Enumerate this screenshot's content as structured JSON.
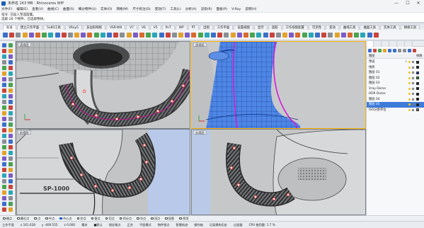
{
  "window": {
    "title": "未命名 163 MB - Rhinoceros WIP",
    "controls": [
      "—",
      "☐",
      "✕"
    ]
  },
  "menu": [
    "文件(F)",
    "编辑(E)",
    "查看(V)",
    "曲线(C)",
    "曲面(S)",
    "细分物件(U)",
    "实体(O)",
    "网格(M)",
    "尺寸标注(D)",
    "变动(T)",
    "工具(L)",
    "分析(A)",
    "渲染(R)",
    "面板(P)",
    "V-Ray",
    "说明(H)"
  ],
  "command": {
    "history": "指令: 已加入至选取集。",
    "prompt": "选取 28 个物件，已选取物体。"
  },
  "toolbar_tabs": [
    "标准",
    "建立工作平面",
    "5x80工具",
    "VRay5",
    "多边形网格",
    "VSR-W8",
    "V7",
    "V6",
    "V5",
    "PnT",
    "WP",
    "PT",
    "出图",
    "工作平面",
    "设置视图",
    "显示",
    "选取",
    "工作视窗配置",
    "可见性",
    "变动",
    "曲线工具",
    "曲面工具",
    "实体工具",
    "网格工具"
  ],
  "toolbar_active": 0,
  "viewports": [
    {
      "name": "Top",
      "title": "透视图"
    },
    {
      "name": "Perspective",
      "title": "透视图"
    },
    {
      "name": "Front",
      "title": "前视图"
    },
    {
      "name": "Right",
      "title": "右视图"
    }
  ],
  "panel": {
    "header": [
      "图层",
      "材质"
    ],
    "layers": [
      {
        "name": "预设",
        "check": "✓",
        "color": "#000000",
        "selected": false
      },
      {
        "name": "线条",
        "check": "",
        "color": "#1a1a1a",
        "selected": false
      },
      {
        "name": "图层 01",
        "check": "",
        "color": "#1a3cc9",
        "selected": false
      },
      {
        "name": "图层 02",
        "check": "",
        "color": "#119922",
        "selected": false
      },
      {
        "name": "图层 03",
        "check": "",
        "color": "#222222",
        "selected": false
      },
      {
        "name": "Vray Dome",
        "check": "",
        "color": "#111111",
        "selected": false
      },
      {
        "name": "HDR Dome",
        "check": "",
        "color": "#111111",
        "selected": false
      },
      {
        "name": "图层 04",
        "check": "",
        "color": "#111111",
        "selected": false
      },
      {
        "name": "图层 05",
        "check": "",
        "color": "#111111",
        "selected": true
      },
      {
        "name": "ISO分割单位",
        "check": "",
        "color": "#777777",
        "selected": false
      }
    ]
  },
  "viewport_tabs": [
    "透视图",
    "上视图",
    "前视图",
    "右视图",
    "+"
  ],
  "osnap": [
    {
      "label": "端点",
      "on": false
    },
    {
      "label": "最近点",
      "on": false
    },
    {
      "label": "点",
      "on": false
    },
    {
      "label": "中点",
      "on": false
    },
    {
      "label": "中心点",
      "on": true
    },
    {
      "label": "交点",
      "on": false
    },
    {
      "label": "垂点",
      "on": false
    },
    {
      "label": "切点",
      "on": false
    },
    {
      "label": "四分点",
      "on": false
    },
    {
      "label": "节点",
      "on": false
    },
    {
      "label": "顶点",
      "on": false
    },
    {
      "label": "投影",
      "on": false
    },
    {
      "label": "停用",
      "on": false
    }
  ],
  "status": {
    "cplane": "工作平面",
    "x": "x 161.628",
    "y": "y -409.555",
    "z": "z 0.000",
    "units": "毫米",
    "layer": "■默认",
    "grid_snap": "锁定格点",
    "ortho": "正交",
    "planar": "平面模式",
    "osnap": "物件锁点",
    "smarttrack": "智慧轨迹",
    "gumball": "操作轴",
    "history": "记录建构历史",
    "filter": "过滤器",
    "cpu": "CPU 使用量: 1.7 %"
  },
  "colors": {
    "accent": "#3d7bd9",
    "viewport_bg": "#c9cacc",
    "blue_viewport": "#5b8ce0",
    "point": "#e61a1a"
  }
}
